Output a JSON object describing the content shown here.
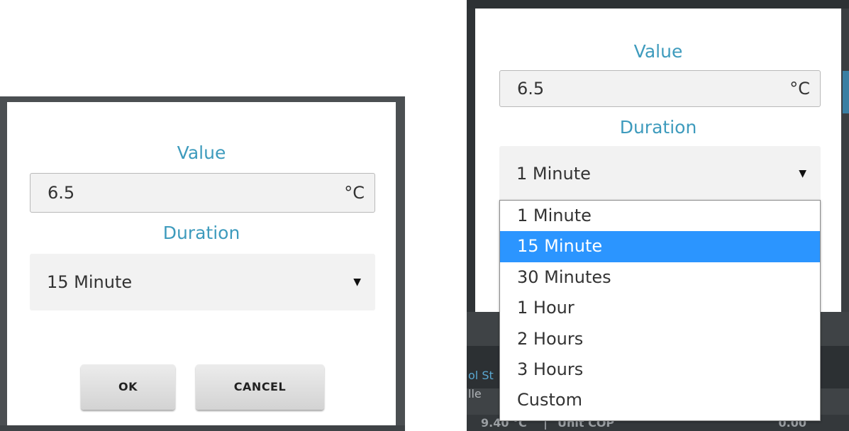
{
  "left_dialog": {
    "value_label": "Value",
    "value_input": "6.5",
    "unit": "°C",
    "duration_label": "Duration",
    "duration_selected": "15 Minute",
    "ok_button": "OK",
    "cancel_button": "CANCEL"
  },
  "right_dialog": {
    "value_label": "Value",
    "value_input": "6.5",
    "unit": "°C",
    "duration_label": "Duration",
    "duration_selected": "1 Minute",
    "options": [
      "1 Minute",
      "15 Minute",
      "30 Minutes",
      "1 Hour",
      "2 Hours",
      "3 Hours",
      "Custom"
    ],
    "highlighted_option": "15 Minute"
  },
  "background": {
    "partial_label_1": "ol St",
    "partial_label_2": "lle",
    "footer_value": "9.40 °C",
    "footer_separator": "|",
    "footer_label": "Unit COP",
    "footer_right_value": "0.00"
  },
  "colors": {
    "label_blue": "#3e9bbd",
    "highlight_blue": "#2b95ff",
    "field_bg": "#f2f2f2"
  },
  "icons": {
    "caret": "▼"
  }
}
